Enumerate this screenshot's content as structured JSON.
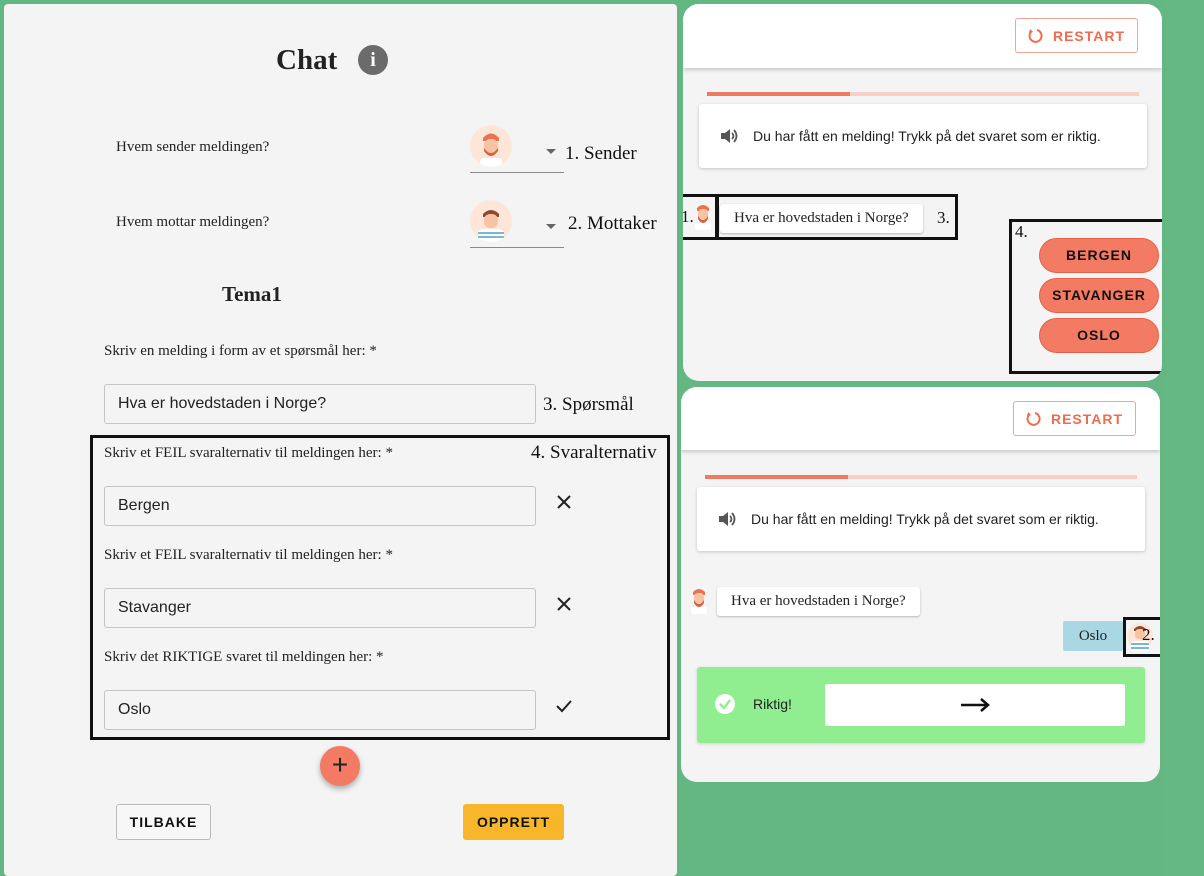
{
  "editor": {
    "title": "Chat",
    "info_icon": "info-icon",
    "sender_question": "Hvem sender meldingen?",
    "receiver_question": "Hvem mottar meldingen?",
    "topic": "Tema1",
    "question_label": "Skriv en melding i form av et spørsmål her: *",
    "question_value": "Hva er hovedstaden i Norge?",
    "answers": [
      {
        "label": "Skriv et FEIL svaralternativ til meldingen her: *",
        "value": "Bergen",
        "icon": "close-icon"
      },
      {
        "label": "Skriv et FEIL svaralternativ til meldingen her: *",
        "value": "Stavanger",
        "icon": "close-icon"
      },
      {
        "label": "Skriv det RIKTIGE svaret til meldingen her: *",
        "value": "Oslo",
        "icon": "check-icon"
      }
    ],
    "add_label": "+",
    "back_label": "TILBAKE",
    "create_label": "OPPRETT"
  },
  "annotations": {
    "sender": "1. Sender",
    "receiver": "2. Mottaker",
    "question": "3. Spørsmål",
    "answers": "4. Svaralternativ",
    "p1_sender": "1.",
    "p1_question": "3.",
    "p1_answers": "4.",
    "p2_receiver": "2."
  },
  "preview1": {
    "restart_label": "RESTART",
    "progress": 0.33,
    "notice": "Du har fått en melding! Trykk på det svaret som er riktig.",
    "question": "Hva er hovedstaden i Norge?",
    "options": [
      "BERGEN",
      "STAVANGER",
      "OSLO"
    ]
  },
  "preview2": {
    "restart_label": "RESTART",
    "progress": 0.33,
    "notice": "Du har fått en melding! Trykk på det svaret som er riktig.",
    "question": "Hva er hovedstaden i Norge?",
    "reply": "Oslo",
    "result_label": "Riktig!",
    "next_icon": "arrow-right-icon"
  },
  "colors": {
    "background": "#64b683",
    "accent": "#f47b63",
    "create": "#f8b72b",
    "correct": "#90ee90",
    "reply": "#a9d7e3"
  }
}
